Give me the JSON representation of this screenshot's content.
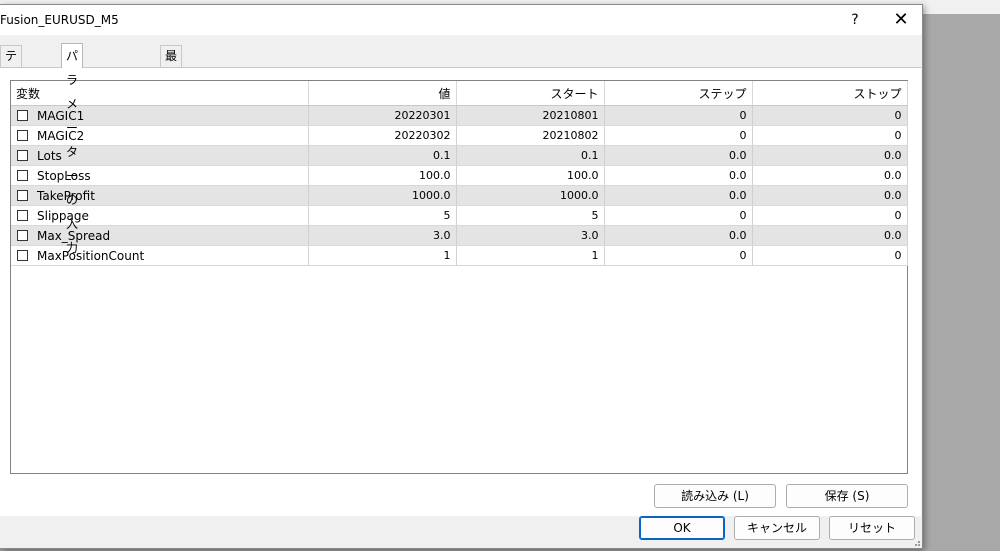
{
  "window": {
    "title": "Fusion_EURUSD_M5",
    "help_label": "?",
    "close_label": "✕"
  },
  "tabs": [
    {
      "label": "テスト設定"
    },
    {
      "label": "パラメーターの入力"
    },
    {
      "label": "最適化"
    }
  ],
  "table": {
    "headers": [
      "変数",
      "値",
      "スタート",
      "ステップ",
      "ストップ"
    ],
    "rows": [
      {
        "name": "MAGIC1",
        "value": "20220301",
        "start": "20210801",
        "step": "0",
        "stop": "0",
        "checked": false
      },
      {
        "name": "MAGIC2",
        "value": "20220302",
        "start": "20210802",
        "step": "0",
        "stop": "0",
        "checked": false
      },
      {
        "name": "Lots",
        "value": "0.1",
        "start": "0.1",
        "step": "0.0",
        "stop": "0.0",
        "checked": false
      },
      {
        "name": "StopLoss",
        "value": "100.0",
        "start": "100.0",
        "step": "0.0",
        "stop": "0.0",
        "checked": false
      },
      {
        "name": "TakeProfit",
        "value": "1000.0",
        "start": "1000.0",
        "step": "0.0",
        "stop": "0.0",
        "checked": false
      },
      {
        "name": "Slippage",
        "value": "5",
        "start": "5",
        "step": "0",
        "stop": "0",
        "checked": false
      },
      {
        "name": "Max_Spread",
        "value": "3.0",
        "start": "3.0",
        "step": "0.0",
        "stop": "0.0",
        "checked": false
      },
      {
        "name": "MaxPositionCount",
        "value": "1",
        "start": "1",
        "step": "0",
        "stop": "0",
        "checked": false
      }
    ]
  },
  "buttons": {
    "load": "読み込み (L)",
    "save": "保存 (S)",
    "ok": "OK",
    "cancel": "キャンセル",
    "reset": "リセット"
  }
}
